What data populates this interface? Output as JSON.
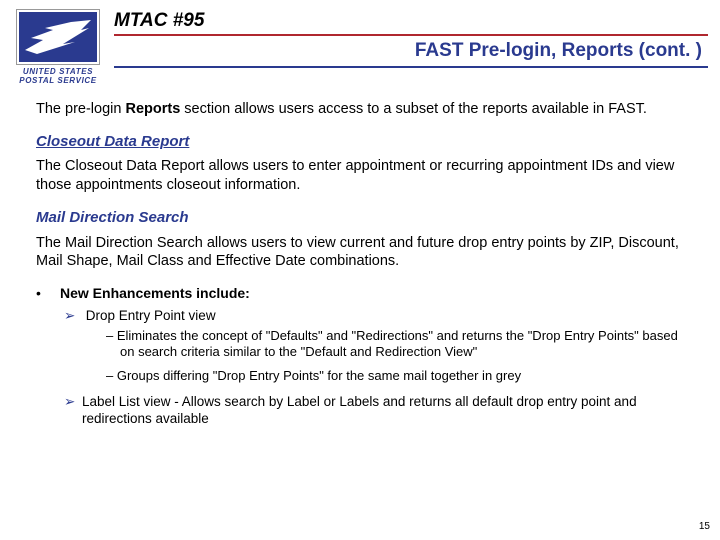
{
  "logo": {
    "org_line1": "UNITED STATES",
    "org_line2": "POSTAL SERVICE"
  },
  "header": {
    "slide_id": "MTAC #95",
    "subtitle": "FAST Pre-login, Reports (cont. )"
  },
  "intro": {
    "pre": "The pre-login ",
    "bold": "Reports ",
    "post": "section allows users access to a subset of the reports available in FAST."
  },
  "section1": {
    "heading": "Closeout Data Report",
    "body": "The Closeout Data Report allows users to enter appointment or recurring appointment IDs and view those appointments closeout information."
  },
  "section2": {
    "heading": "Mail Direction Search",
    "body": "The Mail Direction Search allows users to view current and future drop entry points by ZIP, Discount, Mail Shape, Mail Class and Effective Date combinations."
  },
  "enhancements": {
    "label": "New Enhancements include:",
    "items": [
      {
        "text": "Drop Entry Point view",
        "sub": [
          "Eliminates the concept of \"Defaults\" and \"Redirections\" and returns the \"Drop Entry Points\" based on search criteria similar to the \"Default and Redirection View\"",
          "Groups differing \"Drop Entry Points\" for the same mail together in grey"
        ]
      },
      {
        "text": "Label List view - Allows search by Label or Labels and returns all default drop entry point and redirections available"
      }
    ]
  },
  "page_number": "15"
}
